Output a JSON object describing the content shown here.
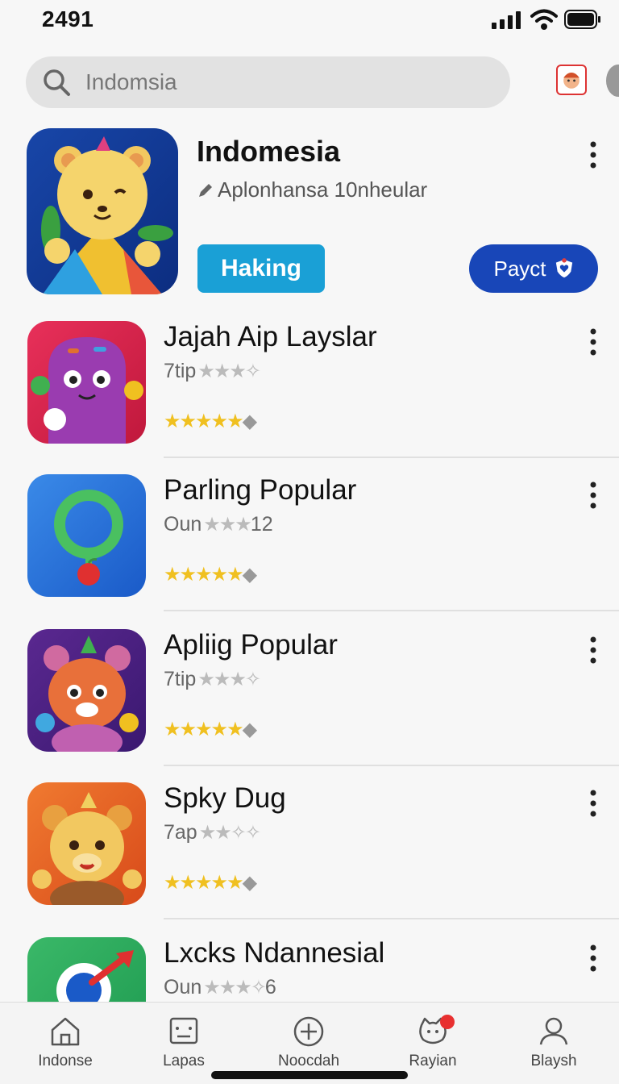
{
  "status": {
    "time": "2491"
  },
  "search": {
    "text": "Indomsia"
  },
  "featured": {
    "title": "Indomesia",
    "subtitle": "Aplonhansa 10nheular",
    "primary_button": "Haking",
    "secondary_button": "Payct"
  },
  "items": [
    {
      "title": "Jajah Aip Layslar",
      "meta": "7tip",
      "rating": 4.5
    },
    {
      "title": "Parling Popular",
      "meta": "Oun",
      "meta_suffix": "12",
      "rating": 4.5
    },
    {
      "title": "Apliig Popular",
      "meta": "7tip",
      "rating": 4.5
    },
    {
      "title": "Spky Dug",
      "meta": "7ap",
      "rating": 4.5
    },
    {
      "title": "Lxcks Ndannesial",
      "meta": "Oun",
      "meta_suffix": "6"
    }
  ],
  "nav": [
    {
      "label": "Indonse",
      "icon": "home-icon"
    },
    {
      "label": "Lapas",
      "icon": "card-icon"
    },
    {
      "label": "Noocdah",
      "icon": "plus-circle-icon"
    },
    {
      "label": "Rayian",
      "icon": "cat-icon"
    },
    {
      "label": "Blaysh",
      "icon": "profile-icon"
    }
  ],
  "colors": {
    "accent": "#1aa0d6",
    "secondary": "#1846b8",
    "star": "#f0c020"
  }
}
